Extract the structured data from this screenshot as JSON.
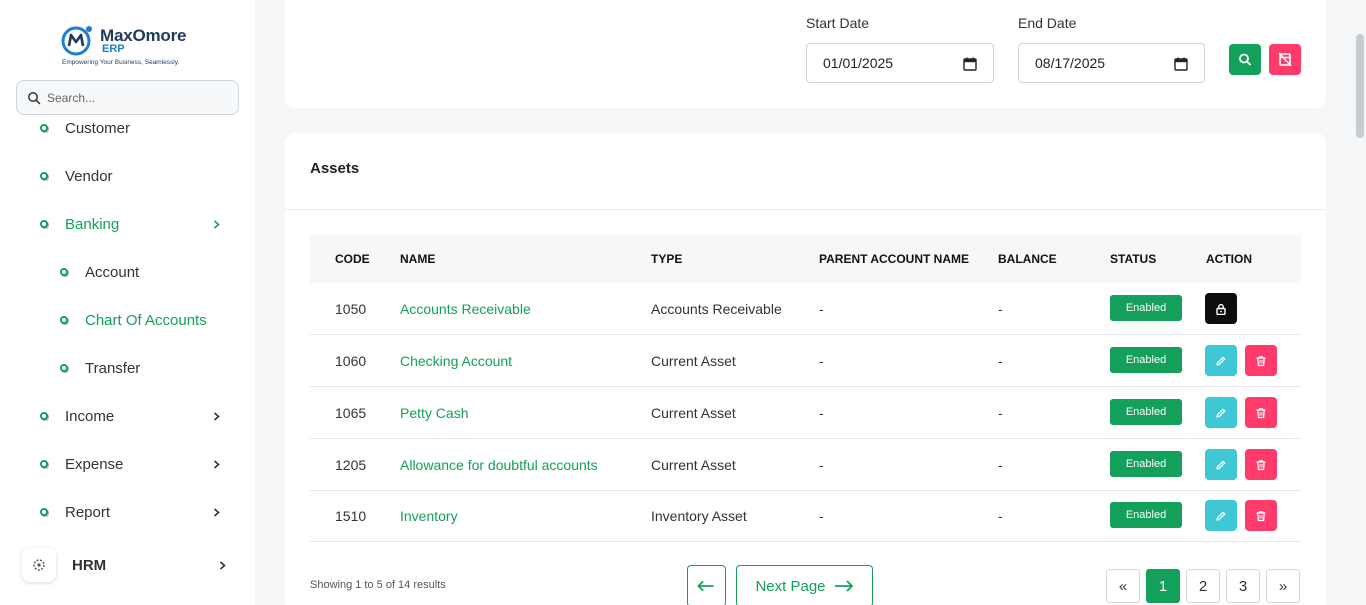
{
  "brand": {
    "name": "MaxOmore",
    "sub": "ERP",
    "tagline": "Empowering Your Business, Seamlessly."
  },
  "search": {
    "placeholder": "Search..."
  },
  "sidebar": {
    "items": [
      {
        "label": "Customer"
      },
      {
        "label": "Vendor"
      },
      {
        "label": "Banking"
      },
      {
        "label": "Account"
      },
      {
        "label": "Chart Of Accounts"
      },
      {
        "label": "Transfer"
      },
      {
        "label": "Income"
      },
      {
        "label": "Expense"
      },
      {
        "label": "Report"
      }
    ],
    "hrm_label": "HRM"
  },
  "filter": {
    "start_label": "Start Date",
    "start_value": "01/01/2025",
    "end_label": "End Date",
    "end_value": "08/17/2025"
  },
  "assets": {
    "title": "Assets",
    "columns": [
      "CODE",
      "NAME",
      "TYPE",
      "PARENT ACCOUNT NAME",
      "BALANCE",
      "STATUS",
      "ACTION"
    ],
    "rows": [
      {
        "code": "1050",
        "name": "Accounts Receivable",
        "type": "Accounts Receivable",
        "parent": "-",
        "balance": "-",
        "status": "Enabled"
      },
      {
        "code": "1060",
        "name": "Checking Account",
        "type": "Current Asset",
        "parent": "-",
        "balance": "-",
        "status": "Enabled"
      },
      {
        "code": "1065",
        "name": "Petty Cash",
        "type": "Current Asset",
        "parent": "-",
        "balance": "-",
        "status": "Enabled"
      },
      {
        "code": "1205",
        "name": "Allowance for doubtful accounts",
        "type": "Current Asset",
        "parent": "-",
        "balance": "-",
        "status": "Enabled"
      },
      {
        "code": "1510",
        "name": "Inventory",
        "type": "Inventory Asset",
        "parent": "-",
        "balance": "-",
        "status": "Enabled"
      }
    ],
    "showing": "Showing 1 to 5 of 14 results",
    "next_label": "Next Page",
    "pages": [
      "1",
      "2",
      "3"
    ],
    "first_symbol": "«",
    "last_symbol": "»"
  },
  "colors": {
    "accent": "#13a05a",
    "danger": "#fe3b6b",
    "edit": "#3ec8d6",
    "dark": "#0d0d0d"
  }
}
